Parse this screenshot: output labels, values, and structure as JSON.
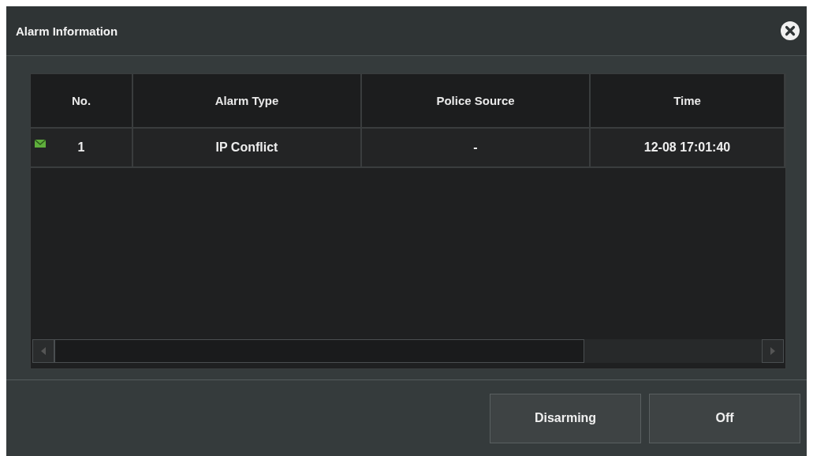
{
  "window": {
    "title": "Alarm Information"
  },
  "table": {
    "columns": [
      "No.",
      "Alarm Type",
      "Police Source",
      "Time"
    ],
    "rows": [
      {
        "no": "1",
        "alarm_type": "IP Conflict",
        "police_source": "-",
        "time": "12-08 17:01:40"
      }
    ]
  },
  "buttons": [
    "Disarming",
    "Off"
  ]
}
